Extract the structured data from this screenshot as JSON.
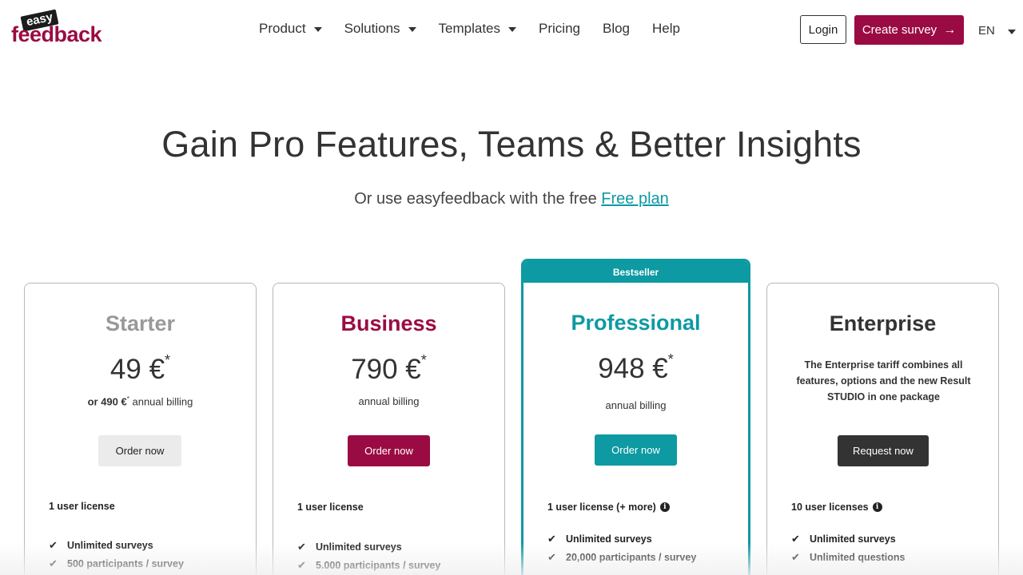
{
  "logo": {
    "top": "easy",
    "bottom": "feedback"
  },
  "nav": {
    "items": [
      {
        "label": "Product",
        "dropdown": true
      },
      {
        "label": "Solutions",
        "dropdown": true
      },
      {
        "label": "Templates",
        "dropdown": true
      },
      {
        "label": "Pricing",
        "dropdown": false
      },
      {
        "label": "Blog",
        "dropdown": false
      },
      {
        "label": "Help",
        "dropdown": false
      }
    ],
    "login_label": "Login",
    "create_label": "Create survey",
    "language": "EN"
  },
  "hero": {
    "title": "Gain Pro Features, Teams & Better Insights",
    "subtitle_prefix": "Or use easyfeedback with the free ",
    "subtitle_link": "Free plan"
  },
  "plans": {
    "starter": {
      "name": "Starter",
      "price": "49 €",
      "asterisk": "*",
      "billing_bold": "or 490 €",
      "billing_sup": "*",
      "billing_rest": " annual billing",
      "button": "Order now",
      "license": "1 user license",
      "features": [
        "Unlimited surveys",
        "500 participants / survey"
      ]
    },
    "business": {
      "name": "Business",
      "price": "790 €",
      "asterisk": "*",
      "billing": "annual billing",
      "button": "Order now",
      "license": "1 user license",
      "features": [
        "Unlimited surveys",
        "5.000 participants / survey"
      ]
    },
    "professional": {
      "ribbon": "Bestseller",
      "name": "Professional",
      "price": "948 €",
      "asterisk": "*",
      "billing": "annual billing",
      "button": "Order now",
      "license": "1 user license (+ more)",
      "features": [
        "Unlimited surveys",
        "20,000 participants / survey"
      ]
    },
    "enterprise": {
      "name": "Enterprise",
      "description": "The Enterprise tariff combines all features, options and the new Result STUDIO in one package",
      "button": "Request now",
      "license": "10 user licenses",
      "features": [
        "Unlimited surveys",
        "Unlimited questions"
      ]
    }
  },
  "colors": {
    "brand": "#9b0b43",
    "teal": "#0d9aa2",
    "dark": "#333333"
  }
}
